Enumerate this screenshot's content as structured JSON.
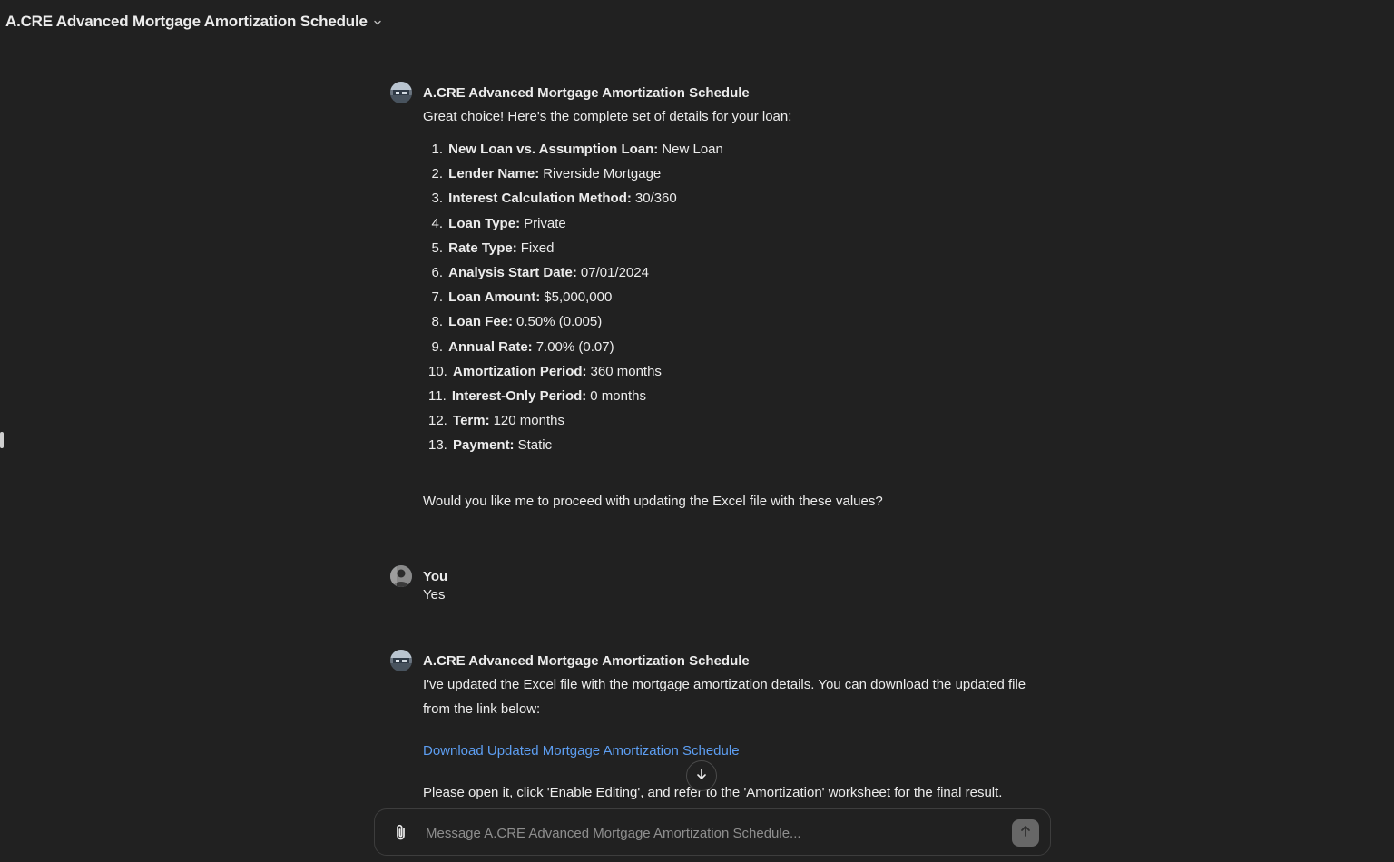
{
  "header": {
    "title": "A.CRE Advanced Mortgage Amortization Schedule"
  },
  "messages": {
    "first": {
      "author": "A.CRE Advanced Mortgage Amortization Schedule",
      "intro": "Great choice! Here's the complete set of details for your loan:",
      "details": [
        {
          "num": "1.",
          "key": "New Loan vs. Assumption Loan:",
          "value": "New Loan"
        },
        {
          "num": "2.",
          "key": "Lender Name:",
          "value": "Riverside Mortgage"
        },
        {
          "num": "3.",
          "key": "Interest Calculation Method:",
          "value": "30/360"
        },
        {
          "num": "4.",
          "key": "Loan Type:",
          "value": "Private"
        },
        {
          "num": "5.",
          "key": "Rate Type:",
          "value": "Fixed"
        },
        {
          "num": "6.",
          "key": "Analysis Start Date:",
          "value": "07/01/2024"
        },
        {
          "num": "7.",
          "key": "Loan Amount:",
          "value": "$5,000,000"
        },
        {
          "num": "8.",
          "key": "Loan Fee:",
          "value": "0.50% (0.005)"
        },
        {
          "num": "9.",
          "key": "Annual Rate:",
          "value": "7.00% (0.07)"
        },
        {
          "num": "10.",
          "key": "Amortization Period:",
          "value": "360 months"
        },
        {
          "num": "11.",
          "key": "Interest-Only Period:",
          "value": "0 months"
        },
        {
          "num": "12.",
          "key": "Term:",
          "value": "120 months"
        },
        {
          "num": "13.",
          "key": "Payment:",
          "value": "Static"
        }
      ],
      "closing": "Would you like me to proceed with updating the Excel file with these values?"
    },
    "user": {
      "author": "You",
      "text": "Yes"
    },
    "second": {
      "author": "A.CRE Advanced Mortgage Amortization Schedule",
      "text": "I've updated the Excel file with the mortgage amortization details. You can download the updated file from the link below:",
      "link": "Download Updated Mortgage Amortization Schedule",
      "footer": "Please open it, click 'Enable Editing', and refer to the 'Amortization' worksheet for the final result."
    }
  },
  "composer": {
    "placeholder": "Message A.CRE Advanced Mortgage Amortization Schedule..."
  },
  "colors": {
    "background": "#212121",
    "link": "#5d9ef2",
    "text": "#ececec"
  }
}
